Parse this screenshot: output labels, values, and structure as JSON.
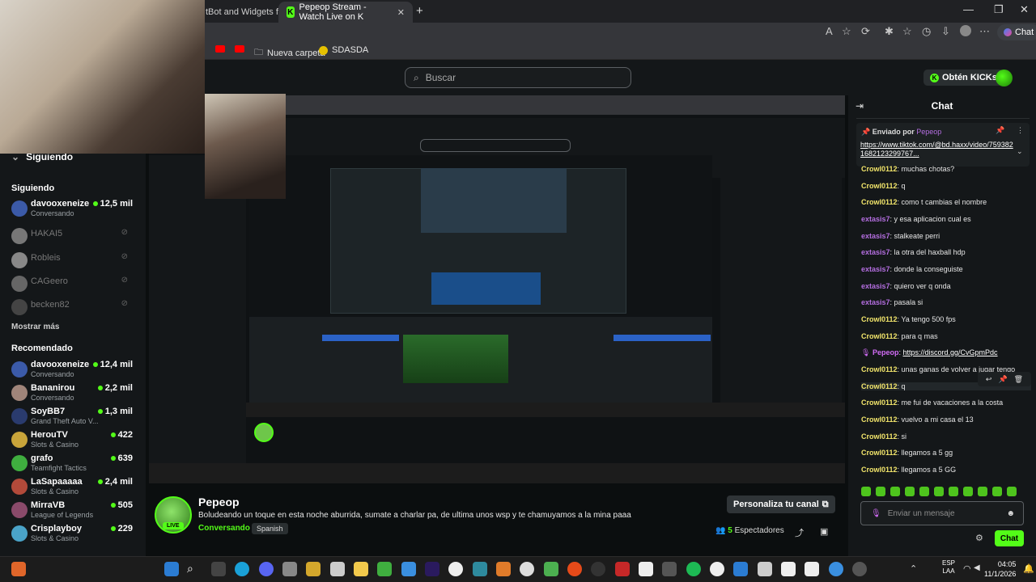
{
  "browser": {
    "tabs": [
      {
        "label": "tBot and Widgets for",
        "active": false
      },
      {
        "label": "Pepeop Stream - Watch Live on K",
        "active": true
      }
    ],
    "chat_button": "Chat",
    "bookmarks": [
      {
        "label": "Nueva carpeta",
        "icon": "folder-icon"
      },
      {
        "label": "SDASDA",
        "icon": "emoji-icon"
      }
    ]
  },
  "header": {
    "search_placeholder": "Buscar",
    "kicks_button": "Obtén KICKs"
  },
  "sidebar": {
    "following_title": "Siguiendo",
    "following": [
      {
        "name": "davooxeneize",
        "sub": "Conversando",
        "viewers": "12,5 mil",
        "live": true
      },
      {
        "name": "HAKAI5",
        "live": false
      },
      {
        "name": "Robleis",
        "live": false
      },
      {
        "name": "CAGeero",
        "live": false
      },
      {
        "name": "becken82",
        "live": false
      }
    ],
    "show_more": "Mostrar más",
    "recommended_title": "Recomendado",
    "recommended": [
      {
        "name": "davooxeneize",
        "sub": "Conversando",
        "viewers": "12,4 mil"
      },
      {
        "name": "Bananirou",
        "sub": "Conversando",
        "viewers": "2,2 mil"
      },
      {
        "name": "SoyBB7",
        "sub": "Grand Theft Auto V...",
        "viewers": "1,3 mil"
      },
      {
        "name": "HerouTV",
        "sub": "Slots & Casino",
        "viewers": "422"
      },
      {
        "name": "grafo",
        "sub": "Teamfight Tactics",
        "viewers": "639"
      },
      {
        "name": "LaSapaaaaa",
        "sub": "Slots & Casino",
        "viewers": "2,4 mil"
      },
      {
        "name": "MirraVB",
        "sub": "League of Legends",
        "viewers": "505"
      },
      {
        "name": "Crisplayboy",
        "sub": "Slots & Casino",
        "viewers": "229"
      }
    ]
  },
  "stream_info": {
    "streamer": "Pepeop",
    "live_badge": "LIVE",
    "title": "Boludeando un toque en esta noche aburrida, sumate a charlar pa, de ultima unos wsp y te chamuyamos a la mina paaa",
    "category": "Conversando",
    "language": "Spanish",
    "customize_button": "Personaliza tu canal",
    "viewers_count": "5",
    "viewers_label": "Espectadores"
  },
  "chat": {
    "title": "Chat",
    "pinned_by_label": "Enviado por",
    "pinned_by_user": "Pepeop",
    "pinned_url": "https://www.tiktok.com/@bd.haxx/video/7593821682123299767...",
    "messages": [
      {
        "user": "Crowl0112",
        "text": "muchas chotas?",
        "type": "crowl"
      },
      {
        "user": "Crowl0112",
        "text": "q",
        "type": "crowl"
      },
      {
        "user": "Crowl0112",
        "text": "como t cambias el nombre",
        "type": "crowl"
      },
      {
        "user": "extasis7",
        "text": "y esa aplicacion cual es",
        "type": "ext"
      },
      {
        "user": "extasis7",
        "text": "stalkeate perri",
        "type": "ext"
      },
      {
        "user": "extasis7",
        "text": "la otra del haxball hdp",
        "type": "ext"
      },
      {
        "user": "extasis7",
        "text": "donde la conseguiste",
        "type": "ext"
      },
      {
        "user": "extasis7",
        "text": "quiero ver q onda",
        "type": "ext"
      },
      {
        "user": "extasis7",
        "text": "pasala si",
        "type": "ext"
      },
      {
        "user": "Crowl0112",
        "text": "Ya tengo 500 fps",
        "type": "crowl"
      },
      {
        "user": "Crowl0112",
        "text": "para q mas",
        "type": "crowl"
      },
      {
        "user": "Pepeop",
        "text": "https://discord.gg/CvGpmPdc",
        "type": "pep"
      },
      {
        "user": "Crowl0112",
        "text": "unas ganas de volver a jugar tengo",
        "type": "crowl"
      },
      {
        "user": "Crowl0112",
        "text": "q",
        "type": "crowl"
      },
      {
        "user": "Crowl0112",
        "text": "me fui de vacaciones a la costa",
        "type": "crowl"
      },
      {
        "user": "Crowl0112",
        "text": "vuelvo a mi casa el 13",
        "type": "crowl"
      },
      {
        "user": "Crowl0112",
        "text": "si",
        "type": "crowl"
      },
      {
        "user": "Crowl0112",
        "text": "llegamos a 5 gg",
        "type": "crowl"
      },
      {
        "user": "Crowl0112",
        "text": "llegamos a 5 GG",
        "type": "crowl"
      }
    ],
    "input_placeholder": "Enviar un mensaje",
    "send_button": "Chat"
  },
  "taskbar": {
    "lang_line1": "ESP",
    "lang_line2": "LAA",
    "time": "04:05",
    "date": "11/1/2026"
  },
  "colors": {
    "accent": "#53fc18",
    "background": "#0b0e0f",
    "panel": "#141719",
    "crowl_user": "#f2e56b",
    "extasis_user": "#b46ee0"
  }
}
